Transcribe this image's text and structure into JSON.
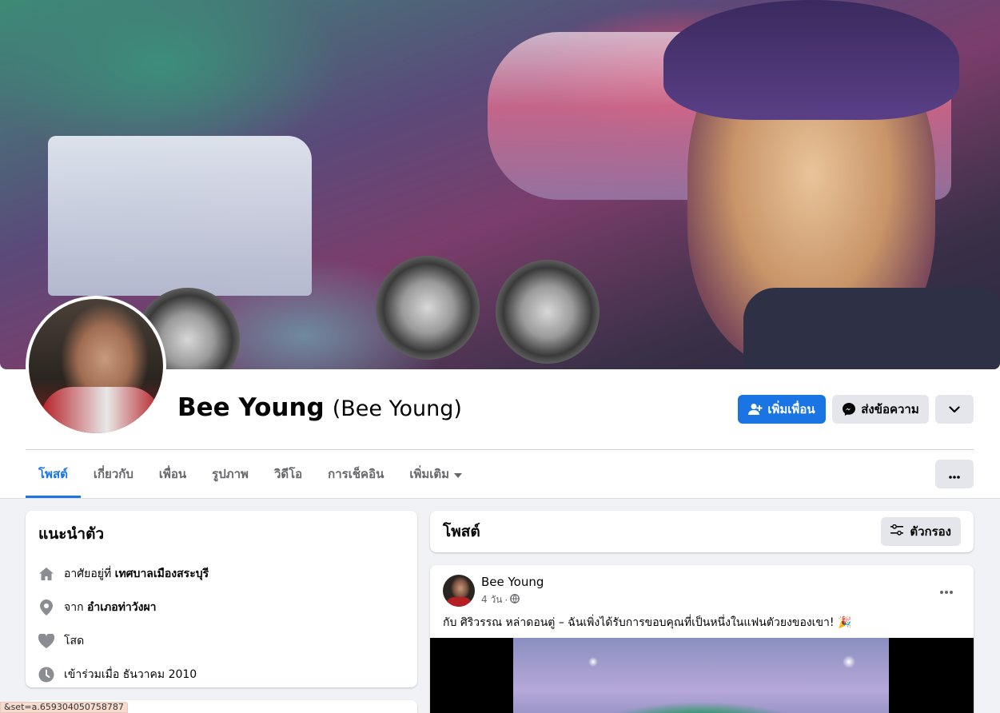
{
  "profile": {
    "name": "Bee Young",
    "alternate_name": "(Bee Young)"
  },
  "actions": {
    "add_friend": "เพิ่มเพื่อน",
    "message": "ส่งข้อความ"
  },
  "tabs": [
    "โพสต์",
    "เกี่ยวกับ",
    "เพื่อน",
    "รูปภาพ",
    "วิดีโอ",
    "การเช็คอิน",
    "เพิ่มเติม"
  ],
  "intro": {
    "title": "แนะนำตัว",
    "lives_in_prefix": "อาศัยอยู่ที่",
    "lives_in_value": "เทศบาลเมืองสระบุรี",
    "from_prefix": "จาก",
    "from_value": "อำเภอท่าวังผา",
    "relationship": "โสด",
    "joined": "เข้าร่วมเมื่อ ธันวาคม 2010"
  },
  "posts": {
    "title": "โพสต์",
    "filter_label": "ตัวกรอง",
    "items": [
      {
        "author": "Bee Young",
        "time": "4 วัน",
        "separator": "·",
        "text": "กับ ศิริวรรณ หล่าดอนตู่ – ฉันเพิ่งได้รับการขอบคุณที่เป็นหนึ่งในแฟนตัวยงของเขา! 🎉"
      }
    ]
  },
  "status_bar": {
    "text": "&set=a.659304050758787"
  },
  "colors": {
    "accent": "#1b74e4",
    "secondary_bg": "#e4e6eb",
    "page_bg": "#f0f2f5",
    "muted_text": "#65676b"
  }
}
